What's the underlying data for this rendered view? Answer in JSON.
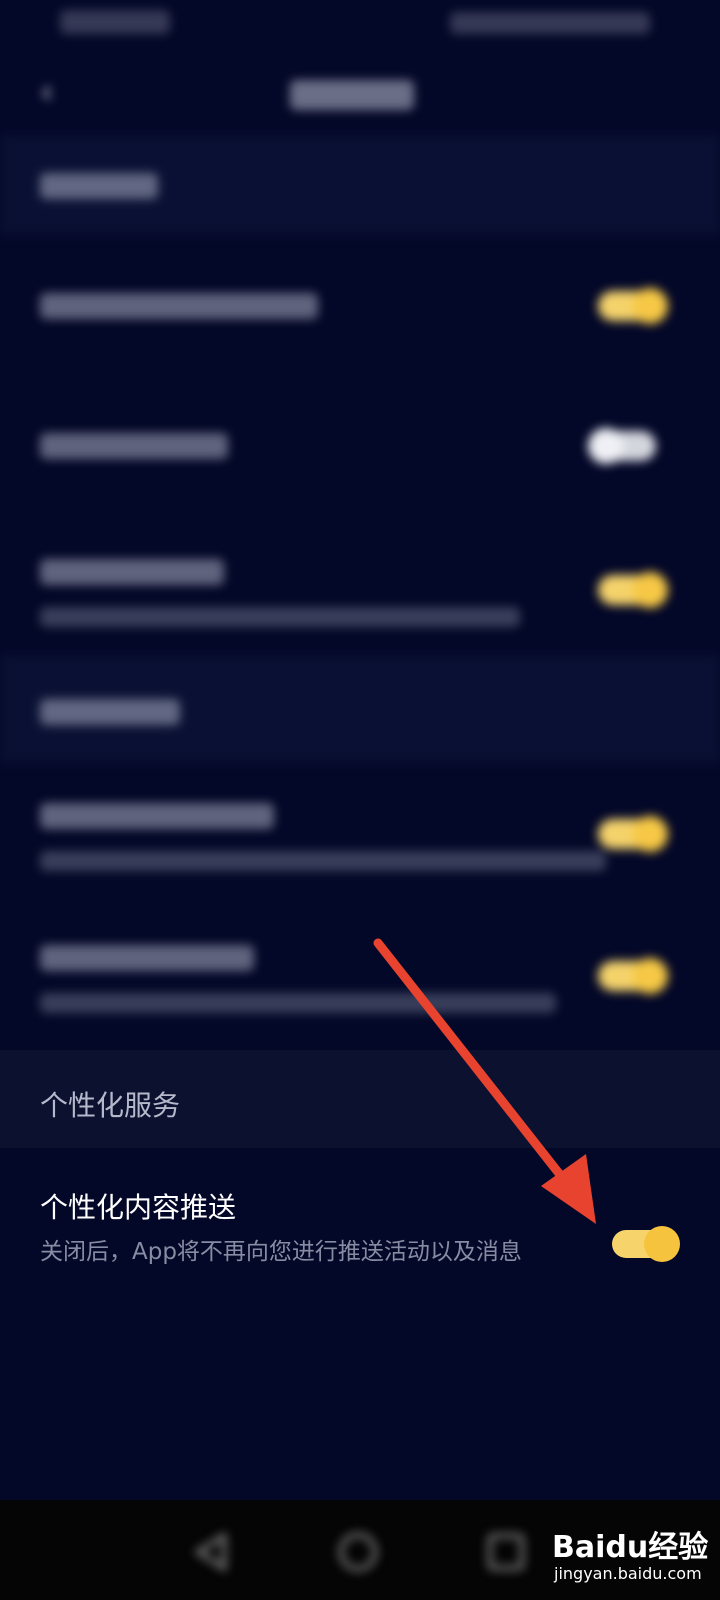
{
  "personal_section": {
    "header": "个性化服务",
    "row_title": "个性化内容推送",
    "row_subtitle": "关闭后，App将不再向您进行推送活动以及消息",
    "toggle_state": "on"
  },
  "colors": {
    "background": "#040828",
    "section_header_bg": "#0c1130",
    "toggle_on": "#f6c846",
    "arrow": "#e8432f"
  },
  "watermark": {
    "logo_text": "Baidu经验",
    "url": "jingyan.baidu.com"
  },
  "icons": [
    "back-arrow-icon",
    "nav-back-icon",
    "nav-home-icon",
    "nav-recent-icon"
  ]
}
